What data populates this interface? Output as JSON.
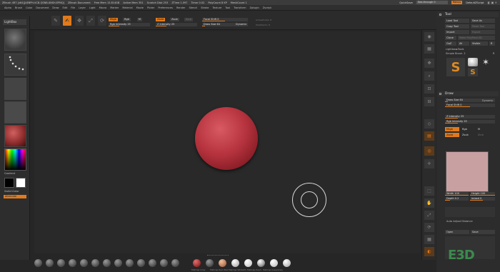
{
  "titlebar": {
    "items": [
      "ZBrush 4R7 [x64][AEBPH-VCB-QSNB-XNSH-EPNQ]",
      "ZBrush Document",
      "Free Mem 13.814GB",
      "Active Mem 351",
      "Scratch Disk 253",
      "ZTime 1.097",
      "Timer 0.02",
      "PolyCount 8 KP",
      "MeshCount 1"
    ],
    "quicksave": "QuickSave",
    "see_through": "See-through 0",
    "menus": "Menus",
    "default_script": "DefaultZScript"
  },
  "menubar": {
    "items": [
      "Alpha",
      "Brush",
      "Color",
      "Document",
      "Draw",
      "Edit",
      "File",
      "Layer",
      "Light",
      "Macro",
      "Marker",
      "Material",
      "Movie",
      "Picker",
      "Preferences",
      "Render",
      "Stencil",
      "Stroke",
      "Texture",
      "Tool",
      "Transform",
      "Zplugin",
      "Zscript"
    ]
  },
  "topshelf": {
    "edit_label": "Edit",
    "draw_label": "Draw",
    "move_label": "Move",
    "scale_label": "Scale",
    "rotate_label": "Rotate",
    "mrgb": "Mrgb",
    "rgb": "Rgb",
    "m": "M",
    "rgb_intensity": "Rgb Intensity 25",
    "zadd": "Zadd",
    "zsub": "Zsub",
    "zcut": "Zcut",
    "z_intensity": "Z Intensity 25",
    "focal_shift": "Focal Shift 0",
    "draw_size": "Draw Size 64",
    "dynamic": "Dynamic",
    "active_points": "ActivePoints: 8",
    "total_points": "TotalPoints: 8"
  },
  "leftshelf": {
    "lightbox": "LightBox",
    "gradient": "Gradient",
    "switch_color": "SwitchColor",
    "alternate": "Alternate"
  },
  "bottomshelf": {
    "materials": [
      "BasicMaterial",
      "MatCap Gray",
      "MatCap Red Wax",
      "MatCap White01",
      "MatCap Pearl",
      "MatCap GreenClay",
      "SkinShade4",
      "Flat Color",
      "ReflectedMap",
      "Chrome"
    ]
  },
  "rightbar": {
    "labels": [
      "BPR",
      "SPix 3",
      "Scroll",
      "Zoom",
      "Actual",
      "AAHalf",
      "Persp",
      "Floor",
      "Local",
      "XYZ",
      "Frame",
      "Move",
      "Scale",
      "Rotate",
      "PolyF",
      "Transp",
      "Ghost",
      "Solo",
      "Xpose"
    ]
  },
  "rightpanel": {
    "tool_title": "Tool",
    "load_tool": "Load Tool",
    "save_as": "Save As",
    "copy_tool": "Copy Tool",
    "paste_tool": "Paste Tool",
    "import": "Import",
    "export": "Export",
    "clone": "Clone",
    "make_polymesh": "Make PolyMesh3D",
    "goz": "GoZ",
    "all": "All",
    "visible": "Visible",
    "r": "R",
    "lightbox_tools": "Lightbox▸Tools",
    "sphere_label": "Simple Brush. 2",
    "r_btn": "R",
    "tool_icon_labels": [
      "SimpleBrush",
      "Cylinder3D",
      "PolyMesh3D"
    ],
    "draw_title": "Draw",
    "draw_size": "Draw Size 64",
    "dynamic": "Dynamic",
    "focal_shift": "Focal Shift 0",
    "z_intensity": "Z Intensity 25",
    "rgb_intensity": "Rgb Intensity 25",
    "mrgb": "Mrgb",
    "rgb": "Rgb",
    "m": "M",
    "zadd": "Zadd",
    "zsub": "Zsub",
    "zcut": "Zcut",
    "width": "Width 100",
    "height": "Height 100",
    "depth": "Depth 0.2",
    "imbed": "Imbed 0",
    "auto_adjust": "Auto Adjust Distance",
    "open": "Open",
    "save": "Save",
    "watermark": "E3D"
  }
}
